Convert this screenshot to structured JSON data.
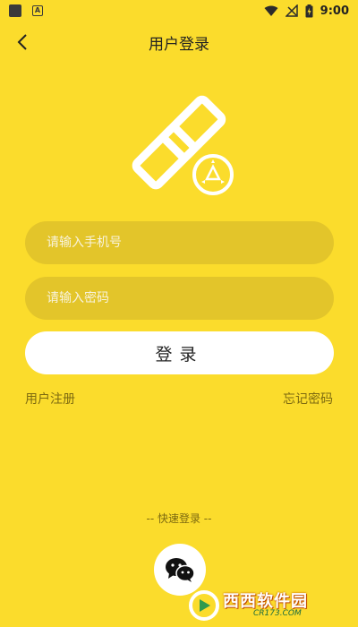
{
  "status_bar": {
    "time": "9:00",
    "icons": [
      "app-icon",
      "a-badge-icon",
      "wifi-icon",
      "signal-off-icon",
      "battery-charging-icon"
    ]
  },
  "nav": {
    "title": "用户登录",
    "back_icon": "chevron-left-icon"
  },
  "logo": {
    "icon": "chain-link-recycle-icon"
  },
  "form": {
    "phone_placeholder": "请输入手机号",
    "password_placeholder": "请输入密码",
    "login_label": "登录"
  },
  "links": {
    "register": "用户注册",
    "forgot": "忘记密码"
  },
  "quick_login": {
    "label": "-- 快速登录 --",
    "icon": "wechat-icon"
  },
  "watermark": {
    "brand": "西西软件园",
    "sub": "CR173.COM"
  },
  "colors": {
    "background": "#fbdc2c",
    "field_fill": "#e3c52a",
    "button_fill": "#ffffff"
  }
}
